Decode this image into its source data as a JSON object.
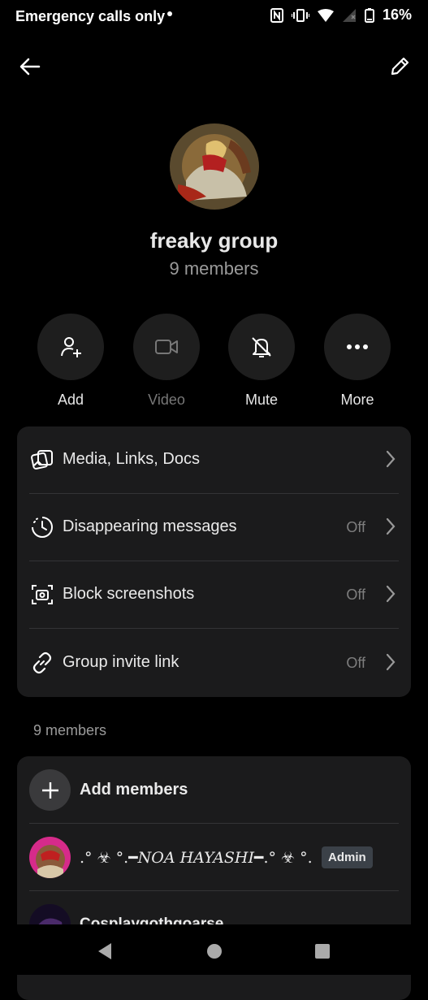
{
  "status_bar": {
    "carrier_text": "Emergency calls only",
    "battery_percent": "16%",
    "icons": [
      "nfc-icon",
      "vibrate-icon",
      "wifi-icon",
      "signal-icon",
      "battery-icon"
    ]
  },
  "top_bar": {
    "back_icon": "arrow-left-icon",
    "edit_icon": "pencil-icon"
  },
  "group": {
    "name": "freaky group",
    "member_count": "9 members"
  },
  "actions": [
    {
      "label": "Add",
      "icon": "add-person-icon",
      "enabled": true
    },
    {
      "label": "Video",
      "icon": "video-camera-icon",
      "enabled": false
    },
    {
      "label": "Mute",
      "icon": "bell-off-icon",
      "enabled": true
    },
    {
      "label": "More",
      "icon": "more-dots-icon",
      "enabled": true
    }
  ],
  "settings": [
    {
      "label": "Media, Links, Docs",
      "value": "",
      "icon": "media-icon"
    },
    {
      "label": "Disappearing messages",
      "value": "Off",
      "icon": "timer-icon"
    },
    {
      "label": "Block screenshots",
      "value": "Off",
      "icon": "screenshot-camera-icon"
    },
    {
      "label": "Group invite link",
      "value": "Off",
      "icon": "link-icon"
    }
  ],
  "members_section": {
    "heading": "9 members",
    "add_label": "Add members",
    "members": [
      {
        "name_prefix": ".° ☣ °.━",
        "name_main": "NOA HAYASHI",
        "name_suffix": "━.° ☣ °.",
        "badge": "Admin"
      },
      {
        "name": "Cosplaygothgoarse"
      }
    ]
  },
  "colors": {
    "background": "#000000",
    "card": "#1b1b1c",
    "action_circle": "#1e1e1e",
    "muted_text": "#9a9a9a",
    "admin_badge": "#3b4148"
  }
}
